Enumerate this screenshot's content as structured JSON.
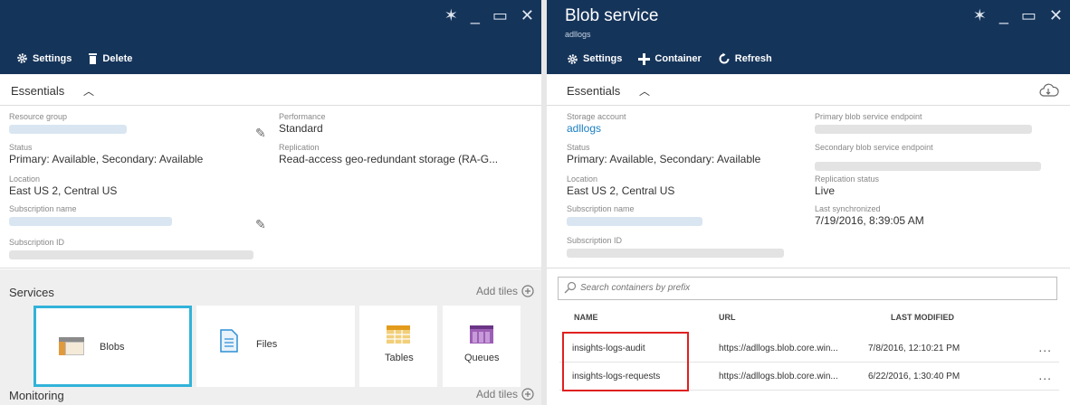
{
  "colors": {
    "header": "#15345a",
    "link": "#1b7ec3",
    "highlight": "#e02020",
    "tile_border": "#31b3d9"
  },
  "left_blade": {
    "commands": {
      "settings": "Settings",
      "delete": "Delete"
    },
    "essentials_label": "Essentials",
    "resource_group_label": "Resource group",
    "performance_label": "Performance",
    "performance_value": "Standard",
    "status_label": "Status",
    "status_value": "Primary: Available, Secondary: Available",
    "replication_label": "Replication",
    "replication_value": "Read-access geo-redundant storage (RA-G...",
    "location_label": "Location",
    "location_value": "East US 2, Central US",
    "subscription_name_label": "Subscription name",
    "subscription_id_label": "Subscription ID",
    "services_title": "Services",
    "add_tiles": "Add tiles",
    "tiles": {
      "blobs": "Blobs",
      "files": "Files",
      "tables": "Tables",
      "queues": "Queues"
    },
    "monitoring_title": "Monitoring",
    "add_tiles_2": "Add tiles"
  },
  "right_blade": {
    "title": "Blob service",
    "subtitle": "adllogs",
    "commands": {
      "settings": "Settings",
      "container": "Container",
      "refresh": "Refresh"
    },
    "essentials_label": "Essentials",
    "storage_account_label": "Storage account",
    "storage_account_value": "adllogs",
    "primary_endpoint_label": "Primary blob service endpoint",
    "status_label": "Status",
    "status_value": "Primary: Available, Secondary: Available",
    "secondary_endpoint_label": "Secondary blob service endpoint",
    "location_label": "Location",
    "location_value": "East US 2, Central US",
    "replication_status_label": "Replication status",
    "replication_status_value": "Live",
    "subscription_name_label": "Subscription name",
    "last_sync_label": "Last synchronized",
    "last_sync_value": "7/19/2016, 8:39:05 AM",
    "subscription_id_label": "Subscription ID",
    "search_placeholder": "Search containers by prefix",
    "table": {
      "headers": {
        "name": "NAME",
        "url": "URL",
        "modified": "LAST MODIFIED"
      },
      "rows": [
        {
          "name": "insights-logs-audit",
          "url": "https://adllogs.blob.core.win...",
          "modified": "7/8/2016, 12:10:21 PM",
          "more": "..."
        },
        {
          "name": "insights-logs-requests",
          "url": "https://adllogs.blob.core.win...",
          "modified": "6/22/2016, 1:30:40 PM",
          "more": "..."
        }
      ]
    }
  }
}
